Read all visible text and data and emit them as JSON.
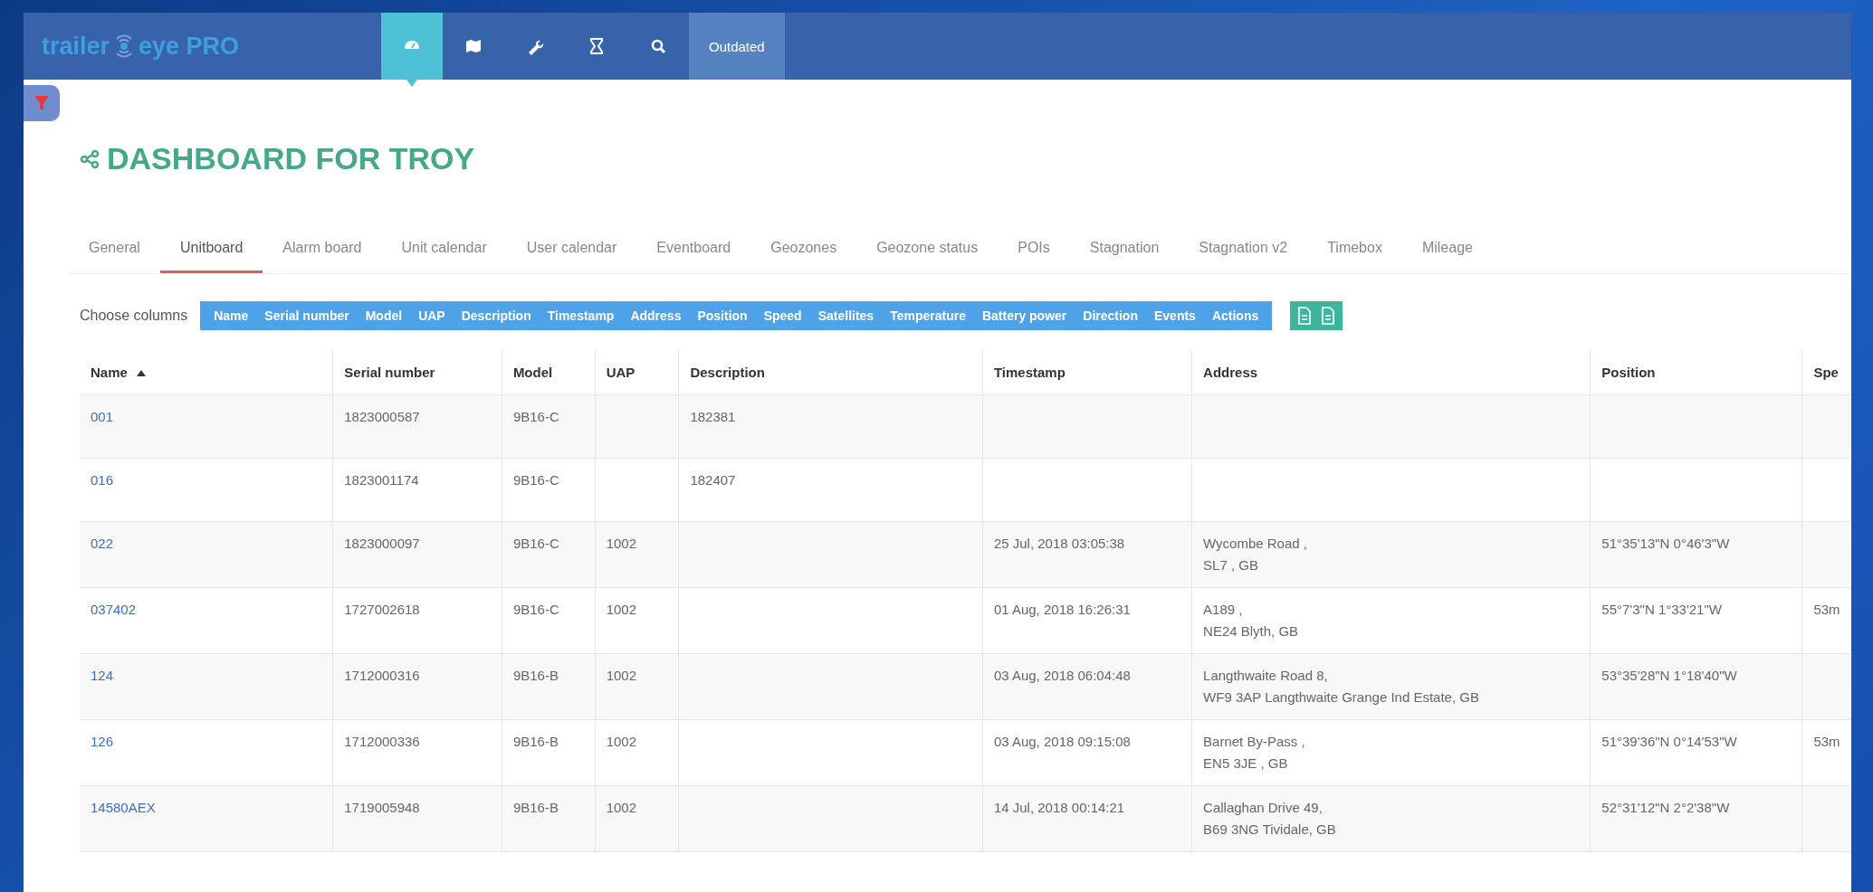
{
  "logo": {
    "text_1": "trailer",
    "text_2": "eye PRO"
  },
  "nav": [
    {
      "kind": "dashboard",
      "selected": true
    },
    {
      "kind": "map",
      "selected": false
    },
    {
      "kind": "wrench",
      "selected": false
    },
    {
      "kind": "hourglass",
      "selected": false
    },
    {
      "kind": "search",
      "selected": false
    },
    {
      "kind": "text",
      "label": "Outdated",
      "selected": false
    }
  ],
  "title": "DASHBOARD FOR TROY",
  "tabs": [
    {
      "label": "General",
      "selected": false
    },
    {
      "label": "Unitboard",
      "selected": true
    },
    {
      "label": "Alarm board",
      "selected": false
    },
    {
      "label": "Unit calendar",
      "selected": false
    },
    {
      "label": "User calendar",
      "selected": false
    },
    {
      "label": "Eventboard",
      "selected": false
    },
    {
      "label": "Geozones",
      "selected": false
    },
    {
      "label": "Geozone status",
      "selected": false
    },
    {
      "label": "POIs",
      "selected": false
    },
    {
      "label": "Stagnation",
      "selected": false
    },
    {
      "label": "Stagnation v2",
      "selected": false
    },
    {
      "label": "Timebox",
      "selected": false
    },
    {
      "label": "Mileage",
      "selected": false
    }
  ],
  "column_chooser": {
    "label": "Choose columns",
    "columns": [
      "Name",
      "Serial number",
      "Model",
      "UAP",
      "Description",
      "Timestamp",
      "Address",
      "Position",
      "Speed",
      "Satellites",
      "Temperature",
      "Battery power",
      "Direction",
      "Events",
      "Actions"
    ]
  },
  "table": {
    "columns": [
      {
        "label": "Name",
        "sorted": true
      },
      {
        "label": "Serial number",
        "sorted": false
      },
      {
        "label": "Model",
        "sorted": false
      },
      {
        "label": "UAP",
        "sorted": false
      },
      {
        "label": "Description",
        "sorted": false
      },
      {
        "label": "Timestamp",
        "sorted": false
      },
      {
        "label": "Address",
        "sorted": false
      },
      {
        "label": "Position",
        "sorted": false
      },
      {
        "label": "Spe",
        "sorted": false
      }
    ],
    "rows": [
      {
        "name": "001",
        "serial": "1823000587",
        "model": "9B16-C",
        "uap": "",
        "description": "182381",
        "timestamp": "",
        "address": [],
        "position": "",
        "speed": ""
      },
      {
        "name": "016",
        "serial": "1823001174",
        "model": "9B16-C",
        "uap": "",
        "description": "182407",
        "timestamp": "",
        "address": [],
        "position": "",
        "speed": ""
      },
      {
        "name": "022",
        "serial": "1823000097",
        "model": "9B16-C",
        "uap": "1002",
        "description": "",
        "timestamp": "25 Jul, 2018 03:05:38",
        "address": [
          "Wycombe Road ,",
          "SL7 , GB"
        ],
        "position": "51°35'13\"N 0°46'3\"W",
        "speed": ""
      },
      {
        "name": "037402",
        "serial": "1727002618",
        "model": "9B16-C",
        "uap": "1002",
        "description": "",
        "timestamp": "01 Aug, 2018 16:26:31",
        "address": [
          "A189 ,",
          "NE24 Blyth, GB"
        ],
        "position": "55°7'3\"N 1°33'21\"W",
        "speed": "53m"
      },
      {
        "name": "124",
        "serial": "1712000316",
        "model": "9B16-B",
        "uap": "1002",
        "description": "",
        "timestamp": "03 Aug, 2018 06:04:48",
        "address": [
          "Langthwaite Road 8,",
          "WF9 3AP Langthwaite Grange Ind Estate, GB"
        ],
        "position": "53°35'28\"N 1°18'40\"W",
        "speed": ""
      },
      {
        "name": "126",
        "serial": "1712000336",
        "model": "9B16-B",
        "uap": "1002",
        "description": "",
        "timestamp": "03 Aug, 2018 09:15:08",
        "address": [
          "Barnet By-Pass ,",
          "EN5 3JE , GB"
        ],
        "position": "51°39'36\"N 0°14'53\"W",
        "speed": "53m"
      },
      {
        "name": "14580AEX",
        "serial": "1719005948",
        "model": "9B16-B",
        "uap": "1002",
        "description": "",
        "timestamp": "14 Jul, 2018 00:14:21",
        "address": [
          "Callaghan Drive 49,",
          "B69 3NG Tividale, GB"
        ],
        "position": "52°31'12\"N 2°2'38\"W",
        "speed": ""
      }
    ]
  }
}
